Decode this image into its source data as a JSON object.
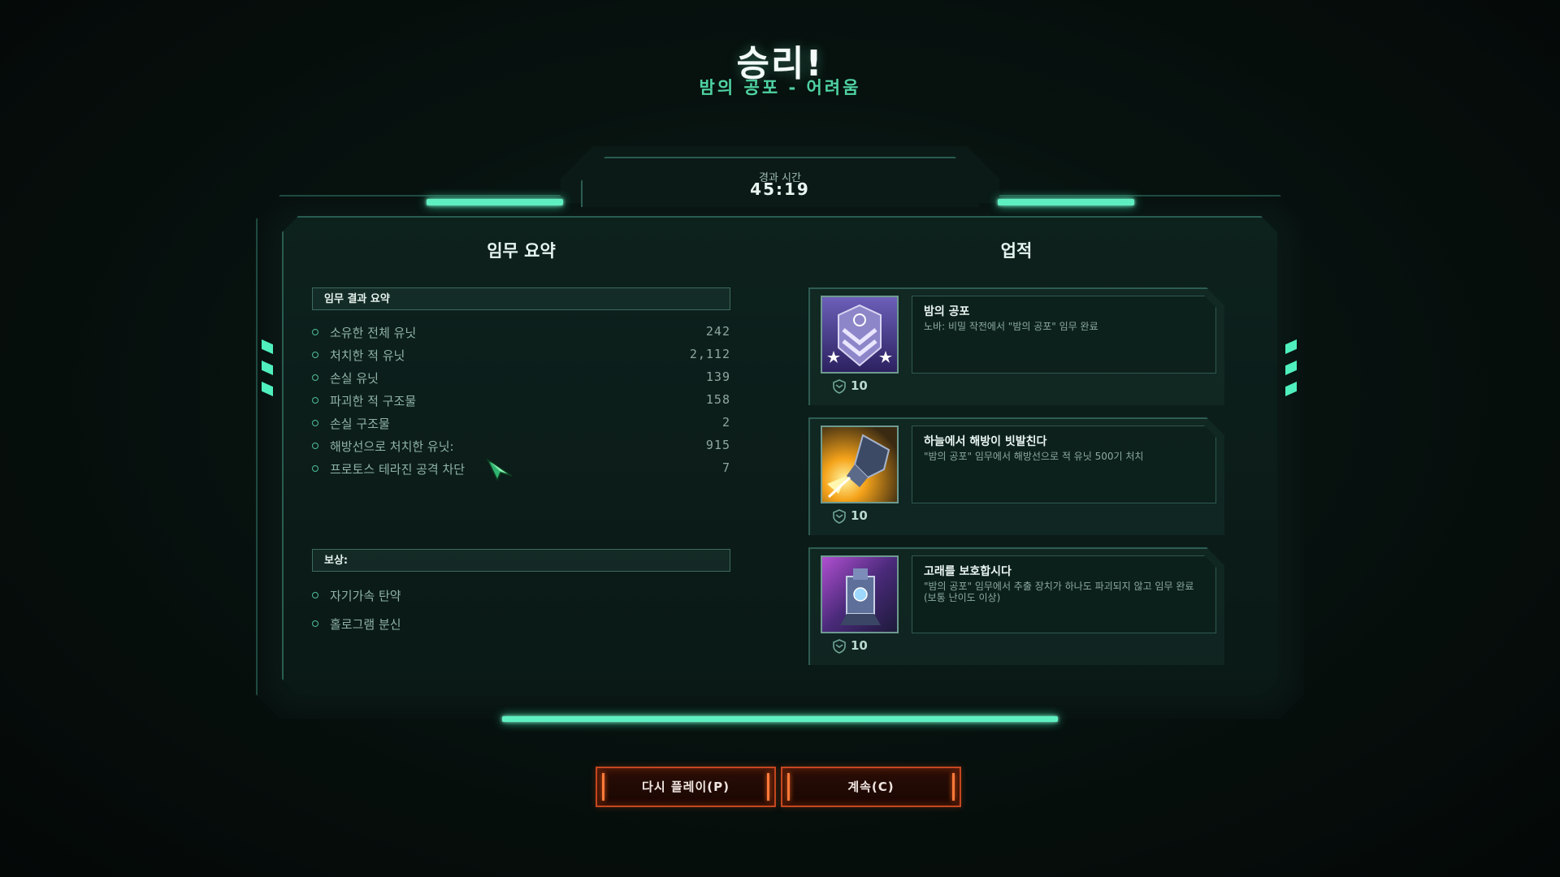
{
  "header": {
    "title": "승리!",
    "subtitle": "밤의 공포 - 어려움"
  },
  "timer": {
    "label": "경과 시간",
    "value": "45:19"
  },
  "summary": {
    "title": "임무 요약",
    "results_header": "임무 결과 요약",
    "stats": [
      {
        "label": "소유한 전체 유닛",
        "value": "242"
      },
      {
        "label": "처치한 적 유닛",
        "value": "2,112"
      },
      {
        "label": "손실 유닛",
        "value": "139"
      },
      {
        "label": "파괴한 적 구조물",
        "value": "158"
      },
      {
        "label": "손실 구조물",
        "value": "2"
      },
      {
        "label": "해방선으로 처치한 유닛:",
        "value": "915"
      },
      {
        "label": "프로토스 테라진 공격 차단",
        "value": "7"
      }
    ],
    "rewards_header": "보상:",
    "rewards": [
      "자기가속 탄약",
      "홀로그램 분신"
    ]
  },
  "achievements": {
    "title": "업적",
    "items": [
      {
        "title": "밤의 공포",
        "desc": "노바: 비밀 작전에서 \"밤의 공포\" 임무 완료",
        "points": "10"
      },
      {
        "title": "하늘에서 해방이 빗발친다",
        "desc": "\"밤의 공포\" 임무에서 해방선으로 적 유닛 500기 처치",
        "points": "10"
      },
      {
        "title": "고래를 보호합시다",
        "desc": "\"밤의 공포\" 임무에서 추출 장치가 하나도 파괴되지 않고 임무 완료 (보통 난이도 이상)",
        "points": "10"
      }
    ]
  },
  "buttons": {
    "replay": "다시 플레이(P)",
    "continue": "계속(C)"
  },
  "colors": {
    "accent": "#5ff0c1",
    "button_border": "#c4471f",
    "subtitle": "#4fd3a3"
  }
}
